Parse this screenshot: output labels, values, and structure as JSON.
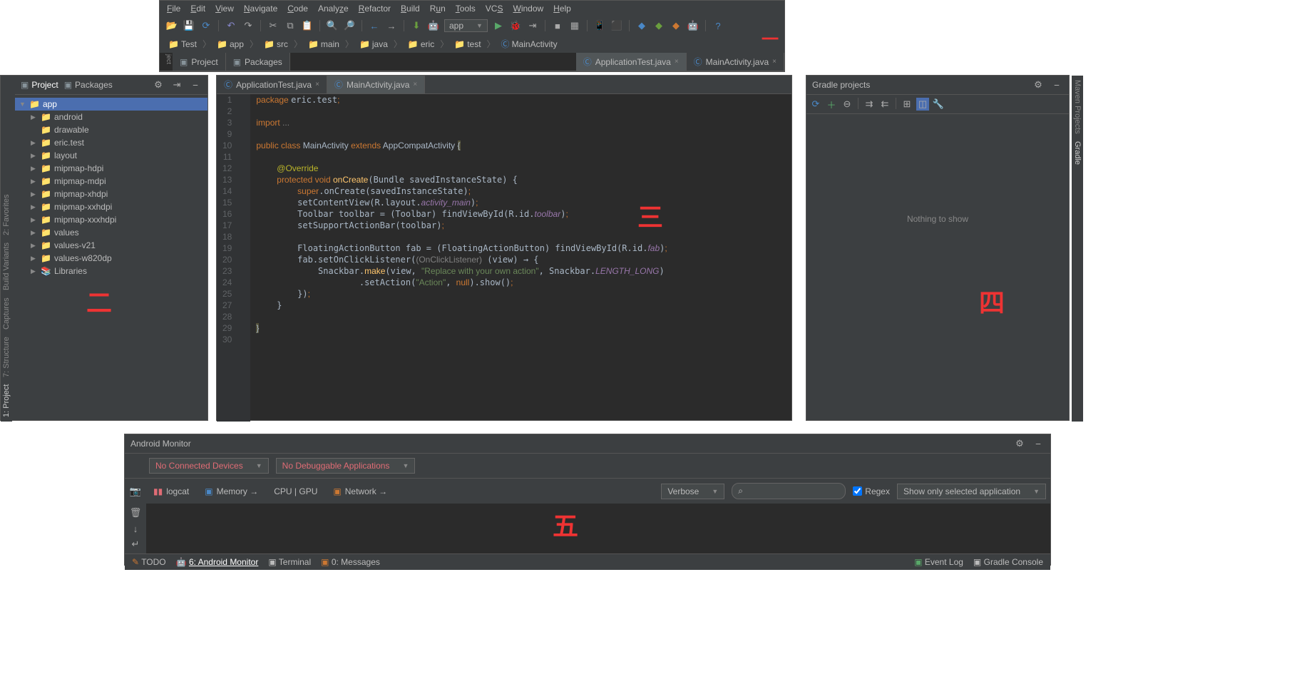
{
  "menu": [
    "File",
    "Edit",
    "View",
    "Navigate",
    "Code",
    "Analyze",
    "Refactor",
    "Build",
    "Run",
    "Tools",
    "VCS",
    "Window",
    "Help"
  ],
  "runconfig": "app",
  "breadcrumb": [
    "Test",
    "app",
    "src",
    "main",
    "java",
    "eric",
    "test",
    "MainActivity"
  ],
  "top_tabs": {
    "project": "Project",
    "packages": "Packages",
    "t1": "ApplicationTest.java",
    "t2": "MainActivity.java"
  },
  "proj_panel": {
    "project": "Project",
    "packages": "Packages"
  },
  "tree": {
    "root": "app",
    "items": [
      "android",
      "drawable",
      "eric.test",
      "layout",
      "mipmap-hdpi",
      "mipmap-mdpi",
      "mipmap-xhdpi",
      "mipmap-xxhdpi",
      "mipmap-xxxhdpi",
      "values",
      "values-v21",
      "values-w820dp",
      "Libraries"
    ]
  },
  "editor_tabs": {
    "t1": "ApplicationTest.java",
    "t2": "MainActivity.java"
  },
  "code": {
    "lines": [
      "1",
      "2",
      "3",
      "9",
      "10",
      "11",
      "12",
      "13",
      "14",
      "15",
      "16",
      "17",
      "18",
      "19",
      "20",
      "23",
      "24",
      "25",
      "27",
      "28",
      "29",
      "30"
    ],
    "pkg_kw": "package ",
    "pkg": "eric.test",
    "semi": ";",
    "imp": "import ",
    "imp_dots": "...",
    "public": "public ",
    "class": "class ",
    "MainActivity": "MainActivity ",
    "extends": "extends ",
    "AppCompat": "AppCompatActivity ",
    "lb": "{",
    "override": "@Override",
    "protected": "protected ",
    "void": "void ",
    "onCreate": "onCreate",
    "params": "(Bundle savedInstanceState) {",
    "super": "super",
    "dot": ".",
    "onCreateCall": "onCreate",
    "args1": "(savedInstanceState)",
    "setContentView": "setContentView",
    "args2": "(R.layout.",
    "actmain": "activity_main",
    ")": ")",
    "ToolbarDecl": "Toolbar toolbar = (Toolbar) findViewById(R.id.",
    "toolbar": "toolbar",
    "setSupport": "setSupportActionBar(toolbar)",
    "FabDecl": "FloatingActionButton fab = (FloatingActionButton) findViewById(R.id.",
    "fab": "fab",
    "fabset": "fab.setOnClickListener(",
    "cast": "(OnClickListener) ",
    "lambda": "(view) → {",
    "Snackbar": "Snackbar",
    "make": ".make(view, ",
    "str1": "\"Replace with your own action\"",
    ", Snackbar.": " , Snackbar.",
    "LL": "LENGTH_LONG",
    "setAction": ".setAction(",
    "str2": "\"Action\"",
    ", null).": " , null).",
    "show": "show",
    "()": "();",
    "rbrace": "}",
    "rparen": "});"
  },
  "gradle": {
    "title": "Gradle projects",
    "empty": "Nothing to show"
  },
  "monitor": {
    "title": "Android Monitor",
    "nodev": "No Connected Devices",
    "nodbg": "No Debuggable Applications",
    "logcat": "logcat",
    "memory": "Memory →",
    "cpu": "CPU | GPU",
    "network": "Network →",
    "verbose": "Verbose",
    "regex": "Regex",
    "filter": "Show only selected application"
  },
  "bottom": {
    "todo": "TODO",
    "am": "6: Android Monitor",
    "term": "Terminal",
    "msg": "0: Messages",
    "evlog": "Event Log",
    "gc": "Gradle Console"
  },
  "leftbar": [
    "1: Project",
    "7: Structure",
    "Captures",
    "Build Variants",
    "2: Favorites"
  ],
  "rightbar": [
    "Maven Projects",
    "Gradle"
  ],
  "marks": {
    "one": "一",
    "two": "二",
    "three": "三",
    "four": "四",
    "five": "五"
  }
}
